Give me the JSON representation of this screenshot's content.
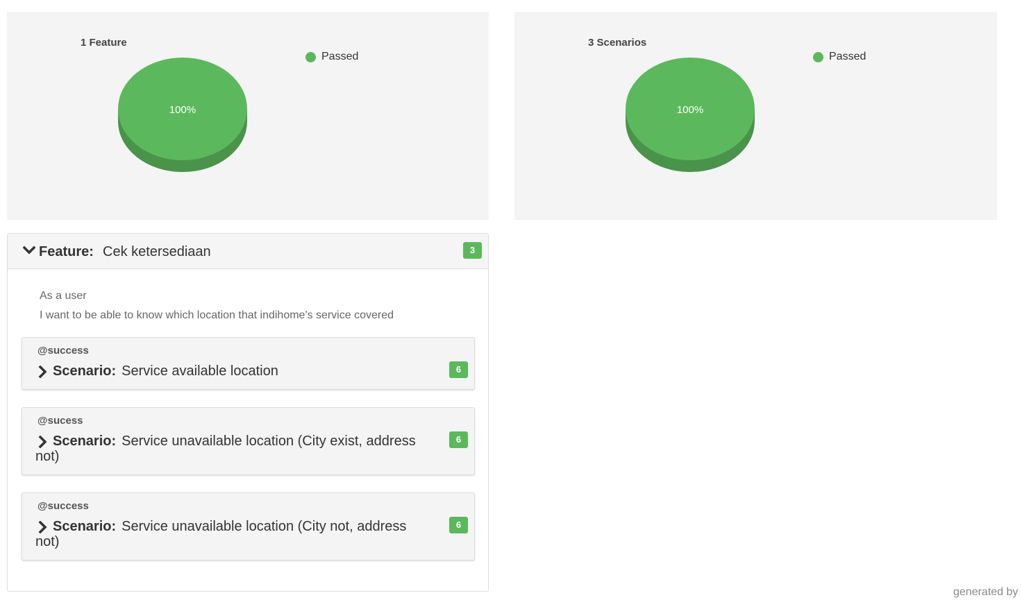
{
  "colors": {
    "passed": "#5cb85c",
    "passed_side": "#4a934a",
    "card_bg": "#f4f4f4",
    "badge_bg": "#5cb85c"
  },
  "charts": {
    "features": {
      "title": "1 Feature",
      "legend_label": "Passed",
      "slice_label": "100%"
    },
    "scenarios": {
      "title": "3 Scenarios",
      "legend_label": "Passed",
      "slice_label": "100%"
    }
  },
  "chart_data": [
    {
      "type": "pie",
      "title": "1 Feature",
      "categories": [
        "Passed"
      ],
      "values": [
        100
      ],
      "data_labels": [
        "100%"
      ],
      "legend": "top-right",
      "colors": [
        "#5cb85c"
      ]
    },
    {
      "type": "pie",
      "title": "3 Scenarios",
      "categories": [
        "Passed"
      ],
      "values": [
        100
      ],
      "data_labels": [
        "100%"
      ],
      "legend": "top-right",
      "colors": [
        "#5cb85c"
      ]
    }
  ],
  "feature": {
    "keyword": "Feature:",
    "name": "Cek ketersediaan",
    "count": "3",
    "description": [
      "As a user",
      "I want to be able to know which location that indihome's service covered"
    ],
    "collapse_icon": "chevron-down-icon"
  },
  "scenarios": [
    {
      "tag": "@success",
      "keyword": "Scenario:",
      "name": "Service available location",
      "count": "6",
      "expand_icon": "chevron-right-icon"
    },
    {
      "tag": "@sucess",
      "keyword": "Scenario:",
      "name": "Service unavailable location (City exist, address not)",
      "count": "6",
      "expand_icon": "chevron-right-icon"
    },
    {
      "tag": "@success",
      "keyword": "Scenario:",
      "name": "Service unavailable location (City not, address not)",
      "count": "6",
      "expand_icon": "chevron-right-icon"
    }
  ],
  "footer": {
    "generated_by": "generated by"
  }
}
